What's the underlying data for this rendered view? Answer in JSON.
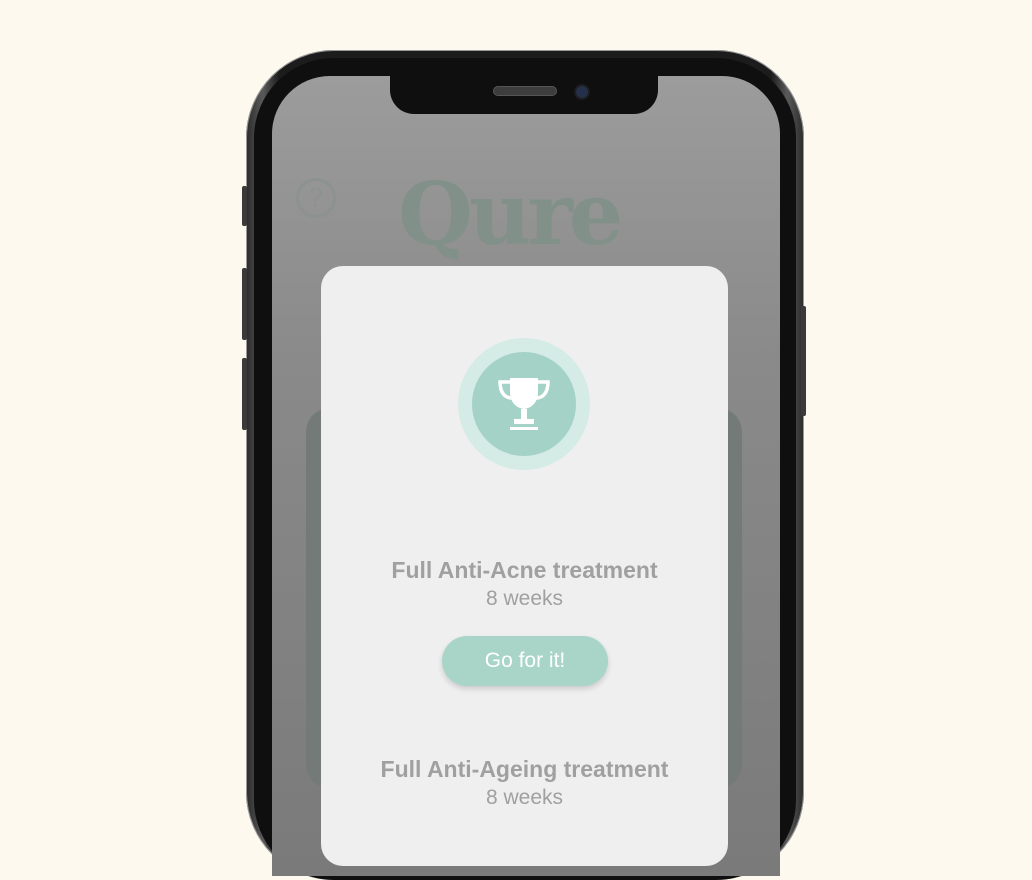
{
  "background_app": {
    "logo_text": "Qure",
    "help_icon": "question-circle-icon"
  },
  "modal": {
    "badge_icon": "trophy-icon",
    "treatments": [
      {
        "title": "Full Anti-Acne treatment",
        "duration": "8 weeks"
      },
      {
        "title": "Full Anti-Ageing treatment",
        "duration": "8 weeks"
      }
    ],
    "cta_label": "Go for it!"
  },
  "colors": {
    "accent": "#a9d5c9",
    "accent_light": "#d5ece6",
    "page_bg": "#fdf9ee",
    "modal_bg": "#efefef",
    "text_muted": "#a0a0a0"
  }
}
